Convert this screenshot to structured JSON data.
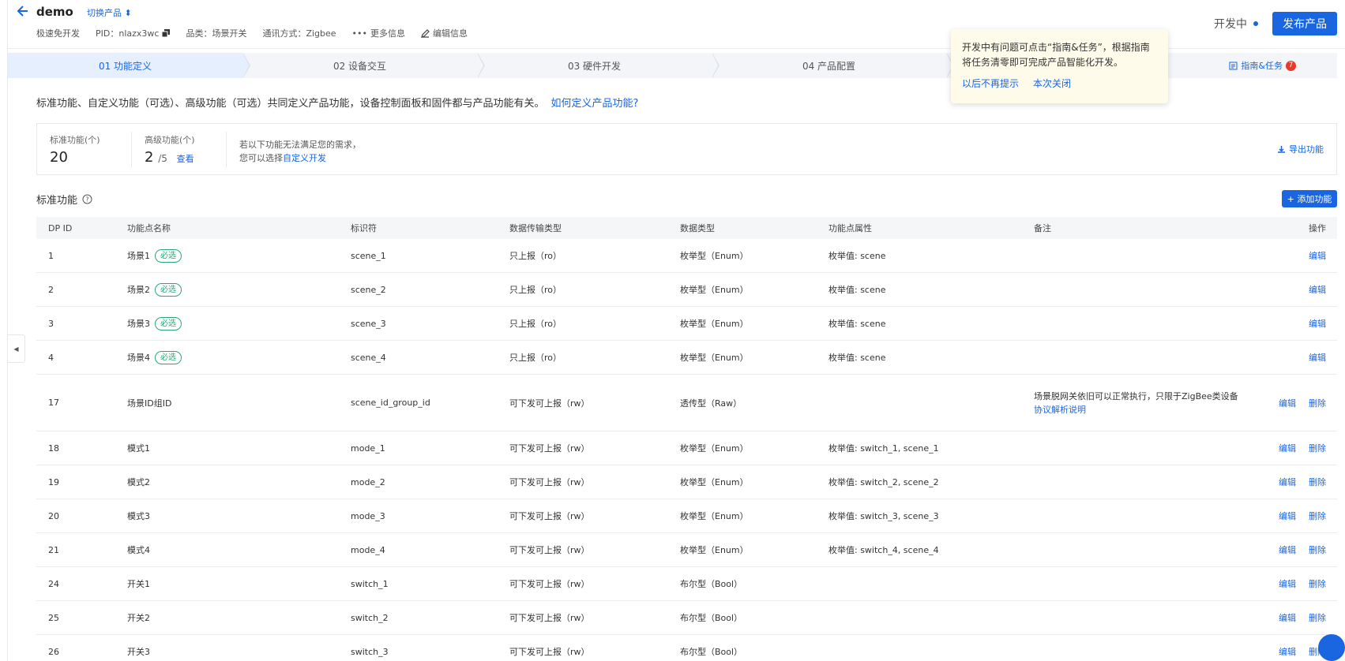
{
  "header": {
    "title": "demo",
    "switch_product": "切换产品 ⬍",
    "meta": {
      "dev_mode": "极速免开发",
      "pid": "PID：nlazx3wc",
      "category": "品类：场景开关",
      "protocol": "通讯方式：Zigbee",
      "more_info": "更多信息",
      "edit_info": "编辑信息"
    },
    "status": "开发中",
    "publish_label": "发布产品"
  },
  "steps": [
    {
      "label": "01 功能定义"
    },
    {
      "label": "02 设备交互"
    },
    {
      "label": "03 硬件开发"
    },
    {
      "label": "04 产品配置"
    }
  ],
  "guide": {
    "label": "指南&任务",
    "badge": "7"
  },
  "popover": {
    "text": "开发中有问题可点击“指南&任务”，根据指南将任务清零即可完成产品智能化开发。",
    "never_show": "以后不再提示",
    "close_once": "本次关闭"
  },
  "intro": {
    "text": "标准功能、自定义功能（可选）、高级功能（可选）共同定义产品功能，设备控制面板和固件都与产品功能有关。",
    "link": "如何定义产品功能?"
  },
  "stats": {
    "standard_label": "标准功能(个)",
    "standard_value": "20",
    "advanced_label": "高级功能(个)",
    "advanced_value": "2",
    "advanced_total": "/5",
    "advanced_view": "查看",
    "note_line1": "若以下功能无法满足您的需求，",
    "note_line2_prefix": "您可以选择",
    "note_line2_link": "自定义开发",
    "export_label": "导出功能"
  },
  "section": {
    "title": "标准功能",
    "add_label": "+ 添加功能"
  },
  "table": {
    "headers": [
      "DP ID",
      "功能点名称",
      "标识符",
      "数据传输类型",
      "数据类型",
      "功能点属性",
      "备注",
      "操作"
    ],
    "required_tag": "必选",
    "edit_label": "编辑",
    "delete_label": "删除",
    "rows": [
      {
        "id": "1",
        "name": "场景1",
        "code": "scene_1",
        "trans": "只上报（ro）",
        "type": "枚举型（Enum）",
        "attr": "枚举值: scene",
        "remark": "",
        "link": "",
        "required": true,
        "deletable": false
      },
      {
        "id": "2",
        "name": "场景2",
        "code": "scene_2",
        "trans": "只上报（ro）",
        "type": "枚举型（Enum）",
        "attr": "枚举值: scene",
        "remark": "",
        "link": "",
        "required": true,
        "deletable": false
      },
      {
        "id": "3",
        "name": "场景3",
        "code": "scene_3",
        "trans": "只上报（ro）",
        "type": "枚举型（Enum）",
        "attr": "枚举值: scene",
        "remark": "",
        "link": "",
        "required": true,
        "deletable": false
      },
      {
        "id": "4",
        "name": "场景4",
        "code": "scene_4",
        "trans": "只上报（ro）",
        "type": "枚举型（Enum）",
        "attr": "枚举值: scene",
        "remark": "",
        "link": "",
        "required": true,
        "deletable": false
      },
      {
        "id": "17",
        "name": "场景ID组ID",
        "code": "scene_id_group_id",
        "trans": "可下发可上报（rw）",
        "type": "透传型（Raw）",
        "attr": "",
        "remark": "场景脱网关依旧可以正常执行，只限于ZigBee类设备",
        "link": "协议解析说明",
        "required": false,
        "deletable": true
      },
      {
        "id": "18",
        "name": "模式1",
        "code": "mode_1",
        "trans": "可下发可上报（rw）",
        "type": "枚举型（Enum）",
        "attr": "枚举值: switch_1, scene_1",
        "remark": "",
        "link": "",
        "required": false,
        "deletable": true
      },
      {
        "id": "19",
        "name": "模式2",
        "code": "mode_2",
        "trans": "可下发可上报（rw）",
        "type": "枚举型（Enum）",
        "attr": "枚举值: switch_2, scene_2",
        "remark": "",
        "link": "",
        "required": false,
        "deletable": true
      },
      {
        "id": "20",
        "name": "模式3",
        "code": "mode_3",
        "trans": "可下发可上报（rw）",
        "type": "枚举型（Enum）",
        "attr": "枚举值: switch_3, scene_3",
        "remark": "",
        "link": "",
        "required": false,
        "deletable": true
      },
      {
        "id": "21",
        "name": "模式4",
        "code": "mode_4",
        "trans": "可下发可上报（rw）",
        "type": "枚举型（Enum）",
        "attr": "枚举值: switch_4, scene_4",
        "remark": "",
        "link": "",
        "required": false,
        "deletable": true
      },
      {
        "id": "24",
        "name": "开关1",
        "code": "switch_1",
        "trans": "可下发可上报（rw）",
        "type": "布尔型（Bool）",
        "attr": "",
        "remark": "",
        "link": "",
        "required": false,
        "deletable": true
      },
      {
        "id": "25",
        "name": "开关2",
        "code": "switch_2",
        "trans": "可下发可上报（rw）",
        "type": "布尔型（Bool）",
        "attr": "",
        "remark": "",
        "link": "",
        "required": false,
        "deletable": true
      },
      {
        "id": "26",
        "name": "开关3",
        "code": "switch_3",
        "trans": "可下发可上报（rw）",
        "type": "布尔型（Bool）",
        "attr": "",
        "remark": "",
        "link": "",
        "required": false,
        "deletable": true
      }
    ]
  },
  "colors": {
    "accent": "#1a66e0",
    "success": "#2aa676",
    "danger": "#e8392c",
    "popover_bg": "#fffbea"
  }
}
